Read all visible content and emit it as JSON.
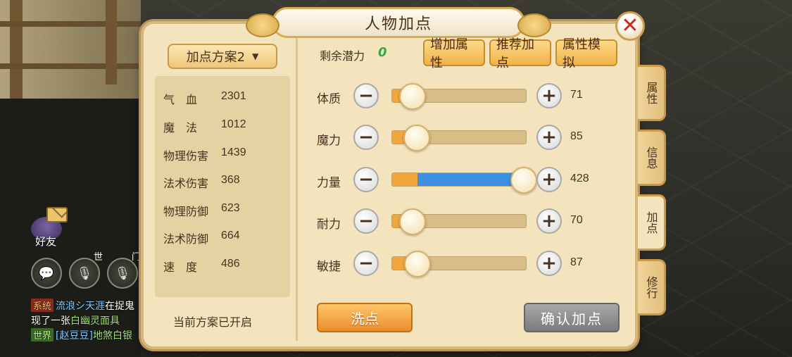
{
  "window": {
    "title": "人物加点",
    "close_icon": "close-icon"
  },
  "plan": {
    "selected": "加点方案2",
    "status": "当前方案已开启"
  },
  "stats": [
    {
      "label": "气　血",
      "value": "2301"
    },
    {
      "label": "魔　法",
      "value": "1012"
    },
    {
      "label": "物理伤害",
      "value": "1439"
    },
    {
      "label": "法术伤害",
      "value": "368"
    },
    {
      "label": "物理防御",
      "value": "623"
    },
    {
      "label": "法术防御",
      "value": "664"
    },
    {
      "label": "速　度",
      "value": "486"
    }
  ],
  "potential": {
    "label": "剩余潜力",
    "value": "0"
  },
  "top_buttons": {
    "add": "增加属性",
    "recommend": "推荐加点",
    "simulate": "属性模拟"
  },
  "attributes": [
    {
      "label": "体质",
      "value": "71"
    },
    {
      "label": "魔力",
      "value": "85"
    },
    {
      "label": "力量",
      "value": "428"
    },
    {
      "label": "耐力",
      "value": "70"
    },
    {
      "label": "敏捷",
      "value": "87"
    }
  ],
  "actions": {
    "wash": "洗点",
    "confirm": "确认加点"
  },
  "tabs": [
    {
      "label": "属性"
    },
    {
      "label": "信息"
    },
    {
      "label": "加点"
    },
    {
      "label": "修行"
    }
  ],
  "hud": {
    "friend_label": "好友",
    "world_channel": "世",
    "sect_channel": "门",
    "chat": {
      "line1": {
        "tag": "系统",
        "player": "流浪シ天涯",
        "text": "在捉鬼"
      },
      "line2": {
        "text": "现了一张",
        "item": "白幽灵面具"
      },
      "line3": {
        "tag": "世界",
        "player": "[赵豆豆]",
        "text": "地煞白银"
      }
    }
  },
  "colors": {
    "accent": "#f0a63a",
    "blue_fill": "#3d8fe0",
    "close": "#d22a1a",
    "potential": "#2fa84a"
  }
}
